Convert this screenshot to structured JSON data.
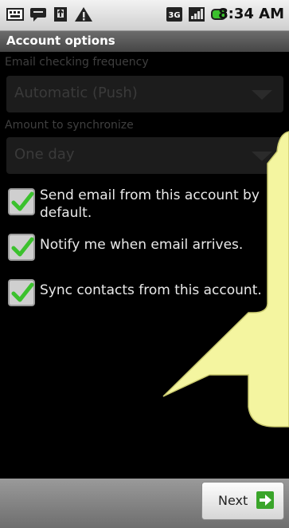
{
  "status": {
    "time": "8:34 AM",
    "icons": [
      "keyboard-icon",
      "chat-icon",
      "usb-icon",
      "warning-icon",
      "3g-icon",
      "signal-icon",
      "battery-icon"
    ]
  },
  "header": {
    "title": "Account options"
  },
  "form": {
    "frequency_label": "Email checking frequency",
    "frequency_value": "Automatic (Push)",
    "sync_label": "Amount to synchronize",
    "sync_value": "One day",
    "checkboxes": [
      {
        "label_line1": "Send email from this account by",
        "label_line2": "default.",
        "checked": true
      },
      {
        "label_line1": "Notify me when email arrives.",
        "label_line2": "",
        "checked": true
      },
      {
        "label_line1": "Sync contacts from this account.",
        "label_line2": "",
        "checked": true
      }
    ]
  },
  "footer": {
    "next_label": "Next"
  },
  "colors": {
    "check": "#3bc12d",
    "callout": "#f4f5a0",
    "next_arrow": "#3aa52a"
  }
}
